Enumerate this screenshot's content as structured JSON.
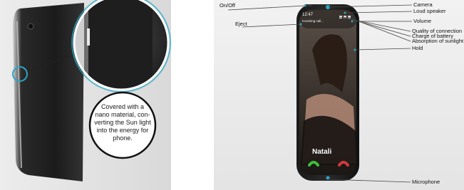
{
  "left_panel": {
    "callout_text": "Covered with a nano material, con-verting the Sun light into the energy for phone."
  },
  "right_panel": {
    "labels": {
      "on_off": "On/Off",
      "eject": "Eject",
      "camera": "Camera",
      "loud_speaker": "Loud speaker",
      "volume": "Volume",
      "quality_of_connection": "Quality of connection",
      "charge_of_battery": "Charge of battery",
      "absorption_of_sunlight": "Absorption of sunlight",
      "hold": "Hold",
      "microphone": "Microphone"
    },
    "screen": {
      "time": "12:47",
      "status": "Incoming call...",
      "caller_name": "Natali"
    },
    "colors": {
      "accent": "#2aa6c4",
      "answer": "#3cbf3c",
      "decline": "#d23a3a"
    }
  }
}
